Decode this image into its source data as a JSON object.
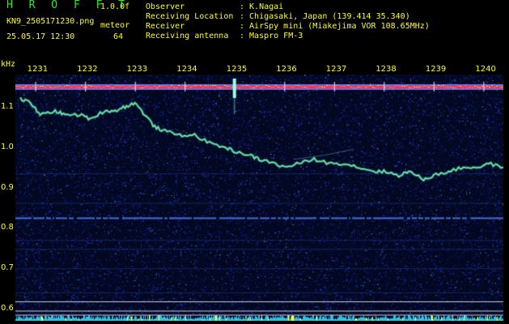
{
  "header": {
    "app_title": "H R O F F T",
    "version": "1.0.0f",
    "filename": "KN9_2505171230.png",
    "datetime": "25.05.17 12:30",
    "meteor_label": "meteor",
    "meteor_count": "64"
  },
  "info": [
    {
      "key": "Observer",
      "value": ": K.Nagai"
    },
    {
      "key": "Receiving Location",
      "value": ": Chigasaki, Japan (139.414 35.340)"
    },
    {
      "key": "Receiver",
      "value": ": AirSpy mini (Miakejima VOR 108.65MHz)"
    },
    {
      "key": "Receiving antenna",
      "value": ": Maspro FM-3"
    }
  ],
  "colors": {
    "title_green": "#22ee22",
    "label_yellow": "#ffff00",
    "background": "#000000",
    "noise_blue": "#1a2a9a",
    "trace_green": "#8cf5d0",
    "carrier_red": "#ff3050"
  },
  "chart_data": {
    "type": "heatmap",
    "unit_label": "kHz",
    "x_ticks": [
      "1231",
      "1232",
      "1233",
      "1234",
      "1235",
      "1236",
      "1237",
      "1238",
      "1239",
      "1240"
    ],
    "y_ticks": [
      "1.1",
      "1.0",
      "0.9",
      "0.8",
      "0.7",
      "0.6"
    ],
    "ylim": [
      0.57,
      1.18
    ],
    "xlim": [
      1230.6,
      1240.4
    ],
    "carrier_khz": 1.15,
    "steady_line_khz": 0.826,
    "drift_trace": [
      [
        1230.7,
        1.12
      ],
      [
        1230.9,
        1.11
      ],
      [
        1231.1,
        1.08
      ],
      [
        1231.4,
        1.09
      ],
      [
        1231.6,
        1.08
      ],
      [
        1231.9,
        1.08
      ],
      [
        1232.1,
        1.07
      ],
      [
        1232.4,
        1.09
      ],
      [
        1232.6,
        1.09
      ],
      [
        1232.8,
        1.1
      ],
      [
        1233.0,
        1.11
      ],
      [
        1233.2,
        1.08
      ],
      [
        1233.4,
        1.05
      ],
      [
        1233.6,
        1.04
      ],
      [
        1233.9,
        1.03
      ],
      [
        1234.2,
        1.03
      ],
      [
        1234.5,
        1.01
      ],
      [
        1234.8,
        1.0
      ],
      [
        1235.0,
        0.99
      ],
      [
        1235.3,
        0.98
      ],
      [
        1235.5,
        0.97
      ],
      [
        1235.8,
        0.96
      ],
      [
        1236.0,
        0.95
      ],
      [
        1236.3,
        0.96
      ],
      [
        1236.6,
        0.97
      ],
      [
        1236.9,
        0.96
      ],
      [
        1237.2,
        0.96
      ],
      [
        1237.5,
        0.95
      ],
      [
        1237.8,
        0.94
      ],
      [
        1238.0,
        0.94
      ],
      [
        1238.3,
        0.93
      ],
      [
        1238.5,
        0.94
      ],
      [
        1238.8,
        0.92
      ],
      [
        1239.0,
        0.93
      ],
      [
        1239.3,
        0.94
      ],
      [
        1239.6,
        0.95
      ],
      [
        1239.9,
        0.95
      ],
      [
        1240.1,
        0.96
      ],
      [
        1240.4,
        0.95
      ]
    ],
    "faint_trace": [
      [
        1236.2,
        0.97
      ],
      [
        1236.8,
        0.98
      ],
      [
        1237.4,
        0.995
      ]
    ]
  }
}
